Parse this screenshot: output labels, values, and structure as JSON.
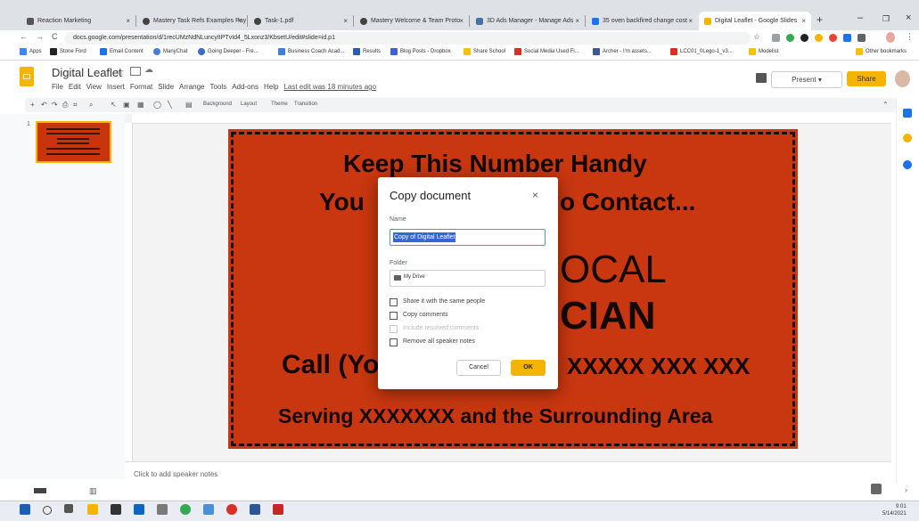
{
  "browser": {
    "tabs": [
      {
        "title": "Reaction Marketing",
        "color": "#555555"
      },
      {
        "title": "Mastery Task Refs Examples Pay",
        "color": "#444444"
      },
      {
        "title": "Task-1.pdf",
        "color": "#444444"
      },
      {
        "title": "Mastery Welcome & Team Proto",
        "color": "#444444"
      },
      {
        "title": "3D Ads Manager - Manage Ads",
        "color": "#4a6fa5"
      },
      {
        "title": "35 oven backfired change cost",
        "color": "#1877f2"
      },
      {
        "title": "Digital Leaflet - Google Slides",
        "color": "#f4b400"
      }
    ],
    "new_tab": "+",
    "window_controls": [
      "–",
      "❐",
      "×"
    ],
    "url": "docs.google.com/presentation/d/1recUMzNdNLuncyIIPTvId4_5Lxonz3/KbsetU/edit#slide=id.p1",
    "nav": {
      "back": "←",
      "forward": "→",
      "reload": "C",
      "lock": "🔒"
    },
    "bookmarks": [
      {
        "label": "Apps",
        "color": "#4285f4"
      },
      {
        "label": "Stone Ford",
        "color": "#222222"
      },
      {
        "label": "Email Content",
        "color": "#1a73e8"
      },
      {
        "label": "ManyChat",
        "color": "#4a7bd0"
      },
      {
        "label": "Going Deeper - Fre...",
        "color": "#3b6bc6"
      },
      {
        "label": "Business Coach Acad...",
        "color": "#3f7fd9"
      },
      {
        "label": "Results",
        "color": "#2b5db5"
      },
      {
        "label": "Blog Posts - Dropbox",
        "color": "#3b63d6"
      },
      {
        "label": "Share School",
        "color": "#f4c20d"
      },
      {
        "label": "Social Media Used Fi...",
        "color": "#d93025"
      },
      {
        "label": "Archer - I'm assets...",
        "color": "#3b5998"
      },
      {
        "label": "LCC01_0Lego-1_v3...",
        "color": "#d93025"
      },
      {
        "label": "Modelist",
        "color": "#f4c20d"
      }
    ],
    "other_bookmarks": "Other bookmarks"
  },
  "slides": {
    "doc_title": "Digital Leaflet",
    "menus": [
      "File",
      "Edit",
      "View",
      "Insert",
      "Format",
      "Slide",
      "Arrange",
      "Tools",
      "Add-ons",
      "Help"
    ],
    "last_edit": "Last edit was 18 minutes ago",
    "present_label": "Present",
    "share_label": "Share",
    "toolbar": {
      "background": "Background",
      "layout": "Layout",
      "theme": "Theme",
      "transition": "Transition"
    },
    "slide_number": "1",
    "notes_placeholder": "Click to add speaker notes",
    "slide_text": {
      "line1": "Keep This Number Handy",
      "line2a": "You",
      "line2b": "o Contact...",
      "line3": "OCAL",
      "line4": "CIAN",
      "line5a": "Call (Yo",
      "line5b": "XXXXX XXX XXX",
      "line6": "Serving XXXXXXX and the Surrounding Area"
    },
    "slide_color": "#c8370f"
  },
  "dialog": {
    "title": "Copy document",
    "close": "×",
    "name_label": "Name",
    "name_value": "Copy of Digital Leaflet",
    "folder_label": "Folder",
    "folder_value": "My Drive",
    "options": [
      {
        "label": "Share it with the same people",
        "checked": false,
        "disabled": false
      },
      {
        "label": "Copy comments",
        "checked": false,
        "disabled": false
      },
      {
        "label": "Include resolved comments",
        "checked": false,
        "disabled": true
      },
      {
        "label": "Remove all speaker notes",
        "checked": false,
        "disabled": false
      }
    ],
    "cancel_label": "Cancel",
    "ok_label": "OK"
  },
  "taskbar": {
    "time": "9:01",
    "date": "5/14/2021"
  }
}
